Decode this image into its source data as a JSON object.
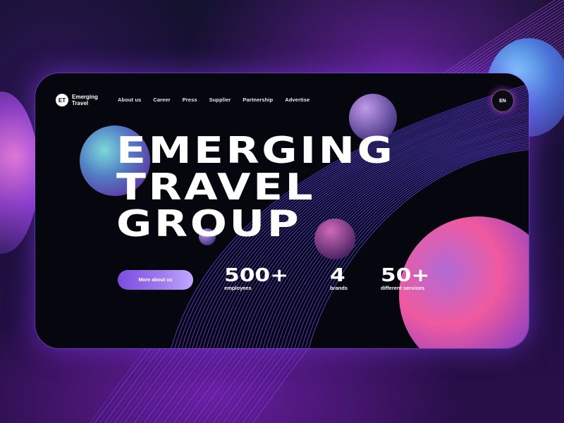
{
  "brand": {
    "mark": "ET",
    "name_line1": "Emerging",
    "name_line2": "Travel"
  },
  "nav": {
    "items": [
      "About us",
      "Career",
      "Press",
      "Supplier",
      "Partnership",
      "Advertise"
    ]
  },
  "language": "EN",
  "hero": {
    "line1": "EMERGING",
    "line2": "TRAVEL",
    "line3": "GROUP"
  },
  "cta": {
    "label": "More about us"
  },
  "stats": [
    {
      "value": "500+",
      "label": "employees"
    },
    {
      "value": "4",
      "label": "brands"
    },
    {
      "value": "50+",
      "label": "different services"
    }
  ],
  "colors": {
    "accent_purple": "#8b5cf6",
    "accent_pink": "#e0459b",
    "glow": "#a855f7"
  }
}
